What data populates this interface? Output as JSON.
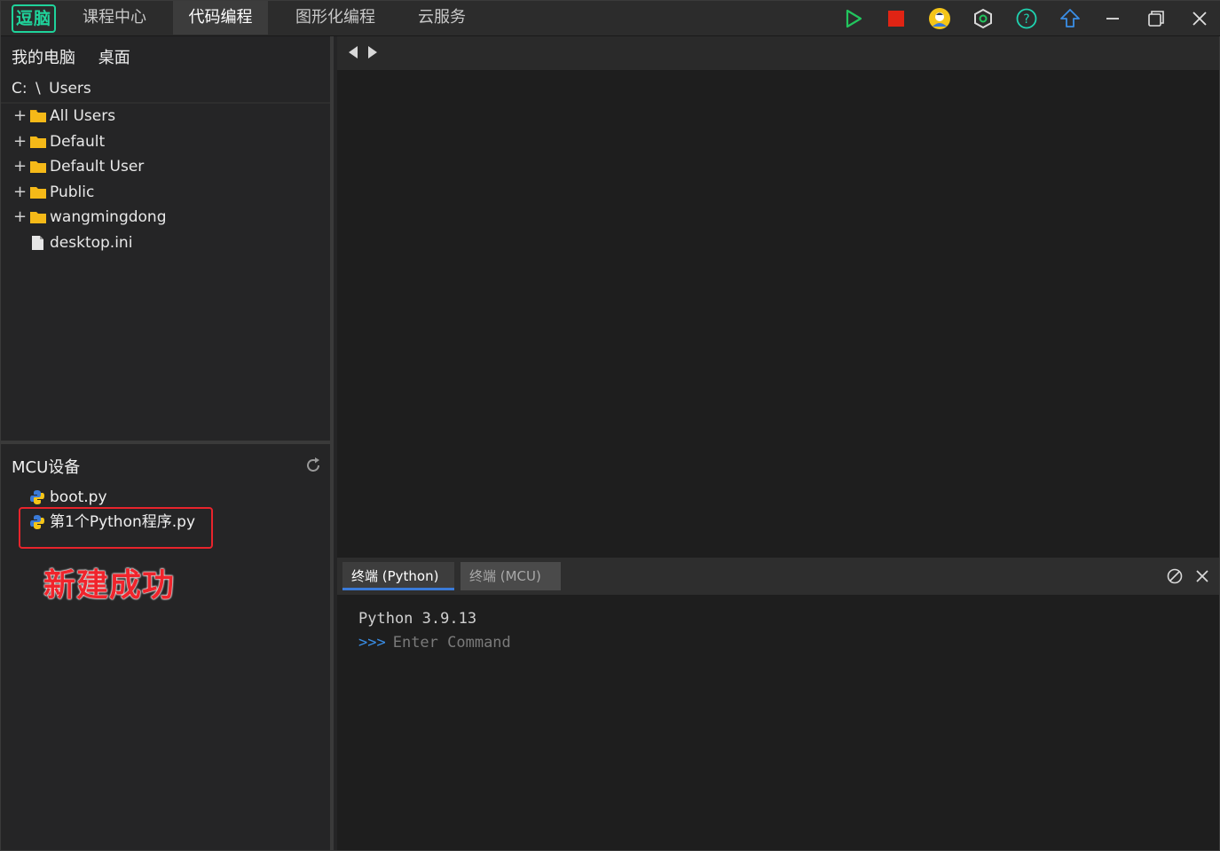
{
  "app": {
    "logo_text": "逗脑",
    "nav_tabs": [
      {
        "label": "课程中心",
        "active": false
      },
      {
        "label": "代码编程",
        "active": true
      },
      {
        "label": "图形化编程",
        "active": false
      },
      {
        "label": "云服务",
        "active": false
      }
    ],
    "toolbar_icons": [
      "run-icon",
      "stop-icon",
      "user-avatar-icon",
      "settings-hex-icon",
      "help-icon",
      "upload-icon",
      "minimize-icon",
      "restore-icon",
      "close-icon"
    ],
    "colors": {
      "accent": "#1fd39b",
      "run": "#22c55e",
      "stop": "#e02414",
      "link": "#3a8ee6",
      "annotation": "#f0242c"
    }
  },
  "explorer": {
    "location_tabs": [
      "我的电脑",
      "桌面"
    ],
    "path": {
      "drive": "C:",
      "separator": "\\",
      "folder": "Users"
    },
    "items": [
      {
        "name": "All Users",
        "type": "folder"
      },
      {
        "name": "Default",
        "type": "folder"
      },
      {
        "name": "Default User",
        "type": "folder"
      },
      {
        "name": "Public",
        "type": "folder"
      },
      {
        "name": "wangmingdong",
        "type": "folder"
      },
      {
        "name": "desktop.ini",
        "type": "file"
      }
    ]
  },
  "mcu": {
    "title": "MCU设备",
    "files": [
      "boot.py",
      "第1个Python程序.py"
    ],
    "annotation": "新建成功"
  },
  "terminal": {
    "tabs": [
      "终端 (Python)",
      "终端 (MCU)"
    ],
    "version_line": "Python 3.9.13",
    "prompt": ">>>",
    "placeholder": "Enter Command"
  }
}
